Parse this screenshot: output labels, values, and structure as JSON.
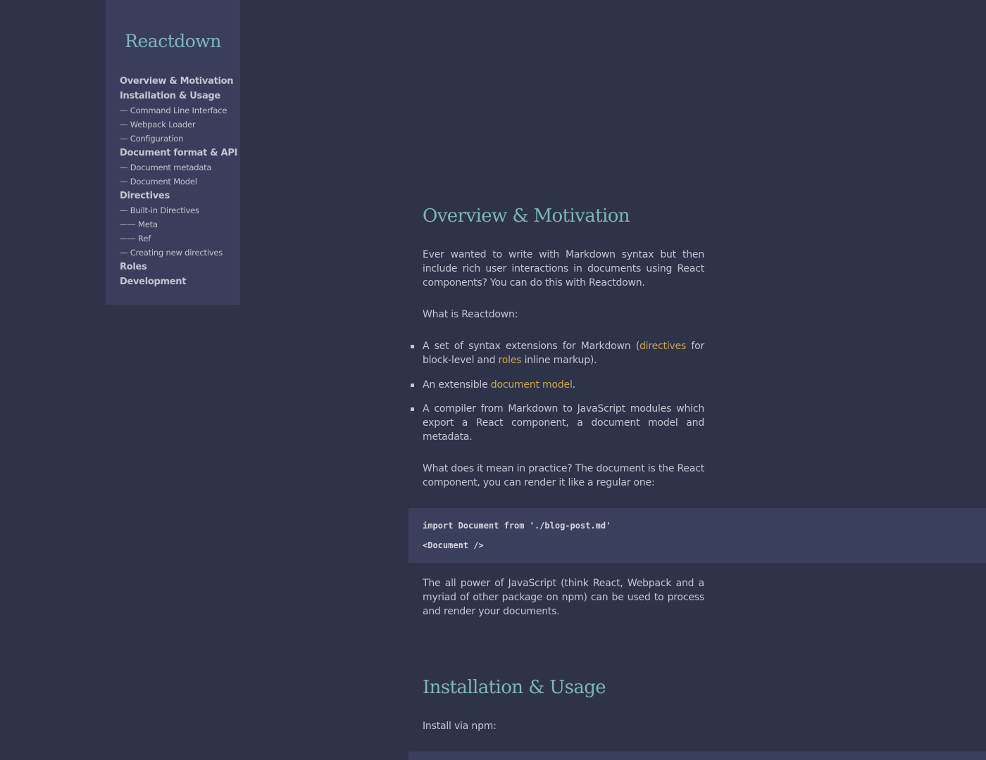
{
  "sidebar": {
    "brand": "Reactdown",
    "toc": [
      {
        "label": "Overview & Motivation",
        "level": 1
      },
      {
        "label": "Installation & Usage",
        "level": 1
      },
      {
        "label": "— Command Line Interface",
        "level": 2
      },
      {
        "label": "— Webpack Loader",
        "level": 2
      },
      {
        "label": "— Configuration",
        "level": 2
      },
      {
        "label": "Document format & API",
        "level": 1
      },
      {
        "label": "— Document metadata",
        "level": 2
      },
      {
        "label": "— Document Model",
        "level": 2
      },
      {
        "label": "Directives",
        "level": 1
      },
      {
        "label": "— Built-in Directives",
        "level": 2
      },
      {
        "label": "—— Meta",
        "level": 3
      },
      {
        "label": "—— Ref",
        "level": 3
      },
      {
        "label": "— Creating new directives",
        "level": 2
      },
      {
        "label": "Roles",
        "level": 1
      },
      {
        "label": "Development",
        "level": 1
      }
    ]
  },
  "overview": {
    "title": "Overview & Motivation",
    "intro": "Ever wanted to write with Markdown syntax but then include rich user interactions in documents using React components? You can do this with Reactdown.",
    "what_is": "What is Reactdown:",
    "bullets": {
      "b1_pre": "A set of syntax extensions for Markdown (",
      "b1_link1": "directives",
      "b1_mid": " for block-level and ",
      "b1_link2": "roles",
      "b1_post": " inline markup).",
      "b2_pre": "An extensible ",
      "b2_link": "document model",
      "b2_post": ".",
      "b3": "A compiler from Markdown to JavaScript modules which export a React component, a document model and metadata."
    },
    "practice": "What does it mean in practice? The document is the React component, you can render it like a regular one:",
    "code_lines": [
      "import Document from './blog-post.md'",
      "<Document />"
    ],
    "power": "The all power of JavaScript (think React, Webpack and a myriad of other package on npm) can be used to process and render your documents."
  },
  "installation": {
    "title": "Installation & Usage",
    "install_via": "Install via npm:"
  },
  "colors": {
    "background": "#2f334a",
    "sidebar": "#3a3e5c",
    "heading": "#7fb3bf",
    "link": "#c9a54f",
    "text": "#c3c5d1",
    "code_bg": "#3b3f5e"
  }
}
